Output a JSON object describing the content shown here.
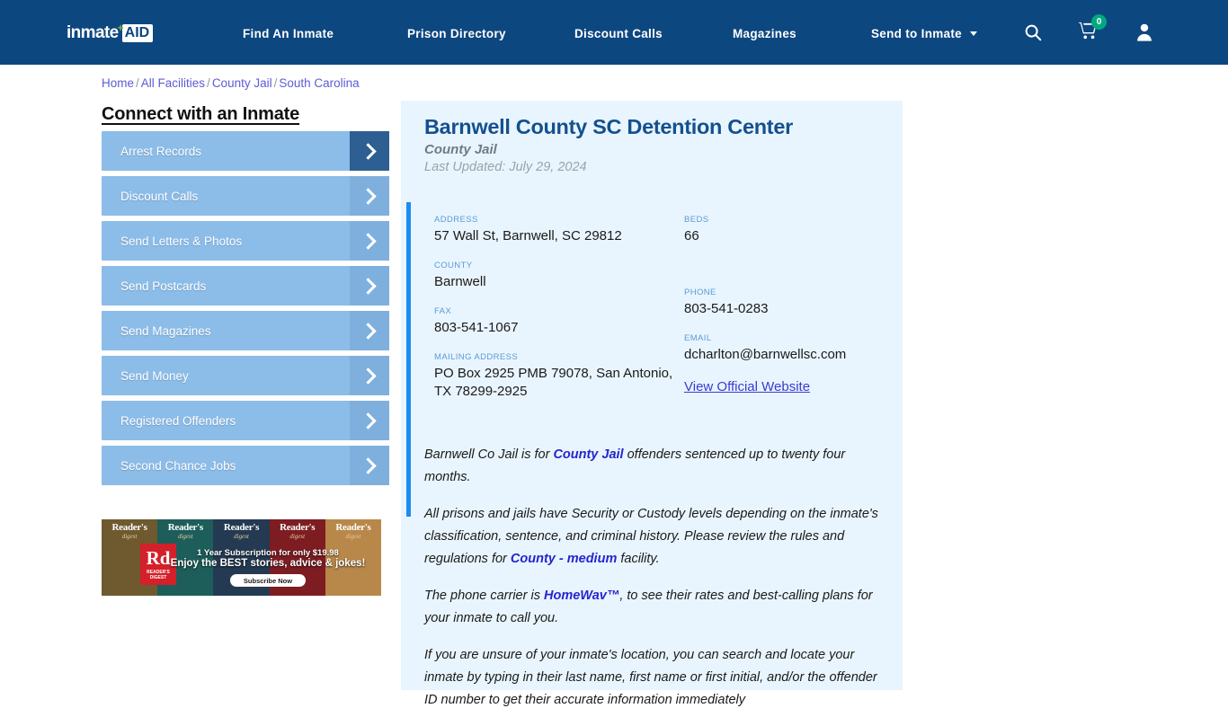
{
  "header": {
    "logo": {
      "word1": "inmate",
      "plus": "+",
      "word2": "AID"
    },
    "nav": [
      {
        "label": "Find An Inmate",
        "has_caret": false
      },
      {
        "label": "Prison Directory",
        "has_caret": false
      },
      {
        "label": "Discount Calls",
        "has_caret": false
      },
      {
        "label": "Magazines",
        "has_caret": false
      },
      {
        "label": "Send to Inmate",
        "has_caret": true
      }
    ],
    "cart_count": "0",
    "colors": {
      "bar": "#0d477f",
      "badge": "#00a97f",
      "plus": "#7ab648"
    }
  },
  "breadcrumb": {
    "items": [
      "Home",
      "All Facilities",
      "County Jail",
      "South Carolina"
    ],
    "separator": "/"
  },
  "sidebar": {
    "title": "Connect with an Inmate",
    "items": [
      {
        "label": "Arrest Records",
        "active": true
      },
      {
        "label": "Discount Calls",
        "active": false
      },
      {
        "label": "Send Letters & Photos",
        "active": false
      },
      {
        "label": "Send Postcards",
        "active": false
      },
      {
        "label": "Send Magazines",
        "active": false
      },
      {
        "label": "Send Money",
        "active": false
      },
      {
        "label": "Registered Offenders",
        "active": false
      },
      {
        "label": "Second Chance Jobs",
        "active": false
      }
    ]
  },
  "ad": {
    "brand_head": "Reader's",
    "brand_sub": "digest",
    "logo_big": "Rd",
    "logo_small": "READER'S\nDIGEST",
    "line1": "1 Year Subscription for only $19.98",
    "line2": "Enjoy the BEST stories, advice & jokes!",
    "cta": "Subscribe Now"
  },
  "facility": {
    "name": "Barnwell County SC Detention Center",
    "type": "County Jail",
    "last_updated": "Last Updated: July 29, 2024",
    "fields_left": [
      {
        "label": "ADDRESS",
        "value": "57 Wall St, Barnwell, SC 29812"
      },
      {
        "label": "COUNTY",
        "value": "Barnwell"
      },
      {
        "label": "FAX",
        "value": "803-541-1067"
      },
      {
        "label": "MAILING ADDRESS",
        "value": "PO Box 2925 PMB 79078, San Antonio, TX 78299-2925"
      }
    ],
    "fields_right": [
      {
        "label": "BEDS",
        "value": "66"
      },
      {
        "label": "PHONE",
        "value": "803-541-0283"
      },
      {
        "label": "EMAIL",
        "value": "dcharlton@barnwellsc.com"
      }
    ],
    "official_website_link": "View Official Website"
  },
  "body": {
    "p1_a": "Barnwell Co Jail is for ",
    "p1_b": "County Jail",
    "p1_c": " offenders sentenced up to twenty four months.",
    "p2_a": "All prisons and jails have Security or Custody levels depending on the inmate's classification, sentence, and criminal history. Please review the rules and regulations for ",
    "p2_b": "County - medium",
    "p2_c": " facility.",
    "p3_a": "The phone carrier is ",
    "p3_b": "HomeWav™",
    "p3_c": ", to see their rates and best-calling plans for your inmate to call you.",
    "p4": "If you are unsure of your inmate's location, you can search and locate your inmate by typing in their last name, first name or first initial, and/or the offender ID number to get their accurate information immediately"
  }
}
